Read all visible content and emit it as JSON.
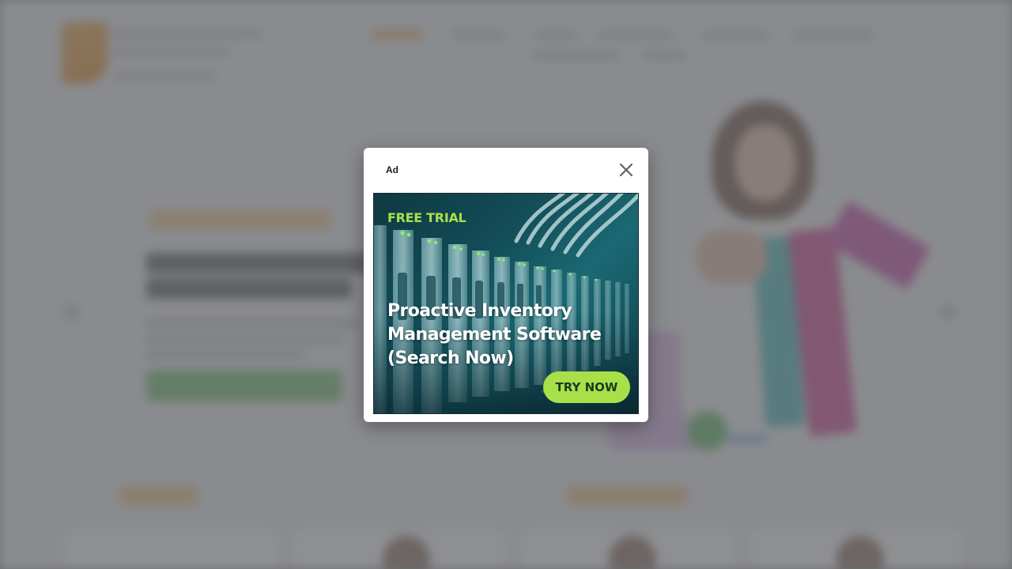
{
  "modal": {
    "ad_label": "Ad",
    "close_icon": "close-icon",
    "creative": {
      "eyebrow": "FREE TRIAL",
      "headline": "Proactive Inventory Management Software (Search Now)",
      "cta": "TRY NOW",
      "colors": {
        "accent": "#a8e04a",
        "background": "#134d58",
        "headline": "#ffffff"
      }
    }
  },
  "background_page": {
    "state": "blurred",
    "accent": "#f0a341",
    "button_color": "#6ec26a"
  }
}
